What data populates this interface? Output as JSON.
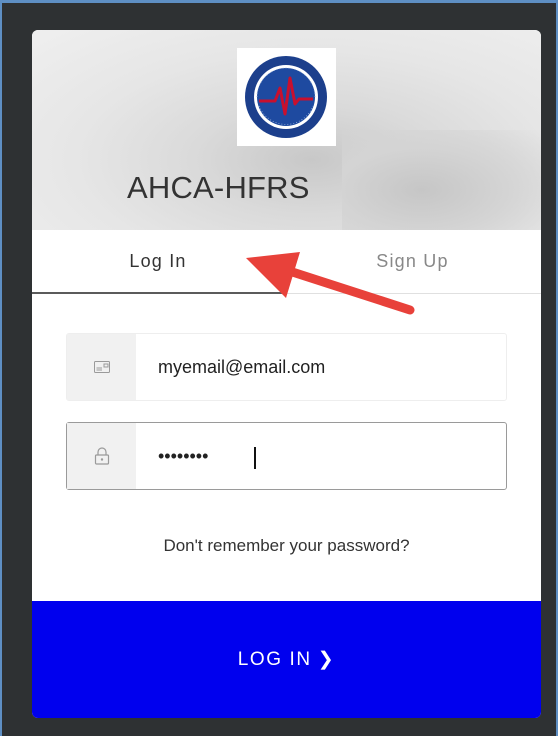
{
  "header": {
    "app_title": "AHCA-HFRS",
    "logo_icon": "agency-seal-icon"
  },
  "tabs": [
    {
      "label": "Log In",
      "active": true
    },
    {
      "label": "Sign Up",
      "active": false
    }
  ],
  "form": {
    "email": {
      "value": "myemail@email.com",
      "icon": "envelope-card-icon"
    },
    "password": {
      "value": "••••••••",
      "icon": "lock-icon"
    },
    "forgot_link": "Don't remember your password?",
    "submit_label": "LOG IN",
    "submit_chevron": "❯"
  },
  "colors": {
    "accent": "#0000ee",
    "annotation_arrow": "#e8413a"
  }
}
